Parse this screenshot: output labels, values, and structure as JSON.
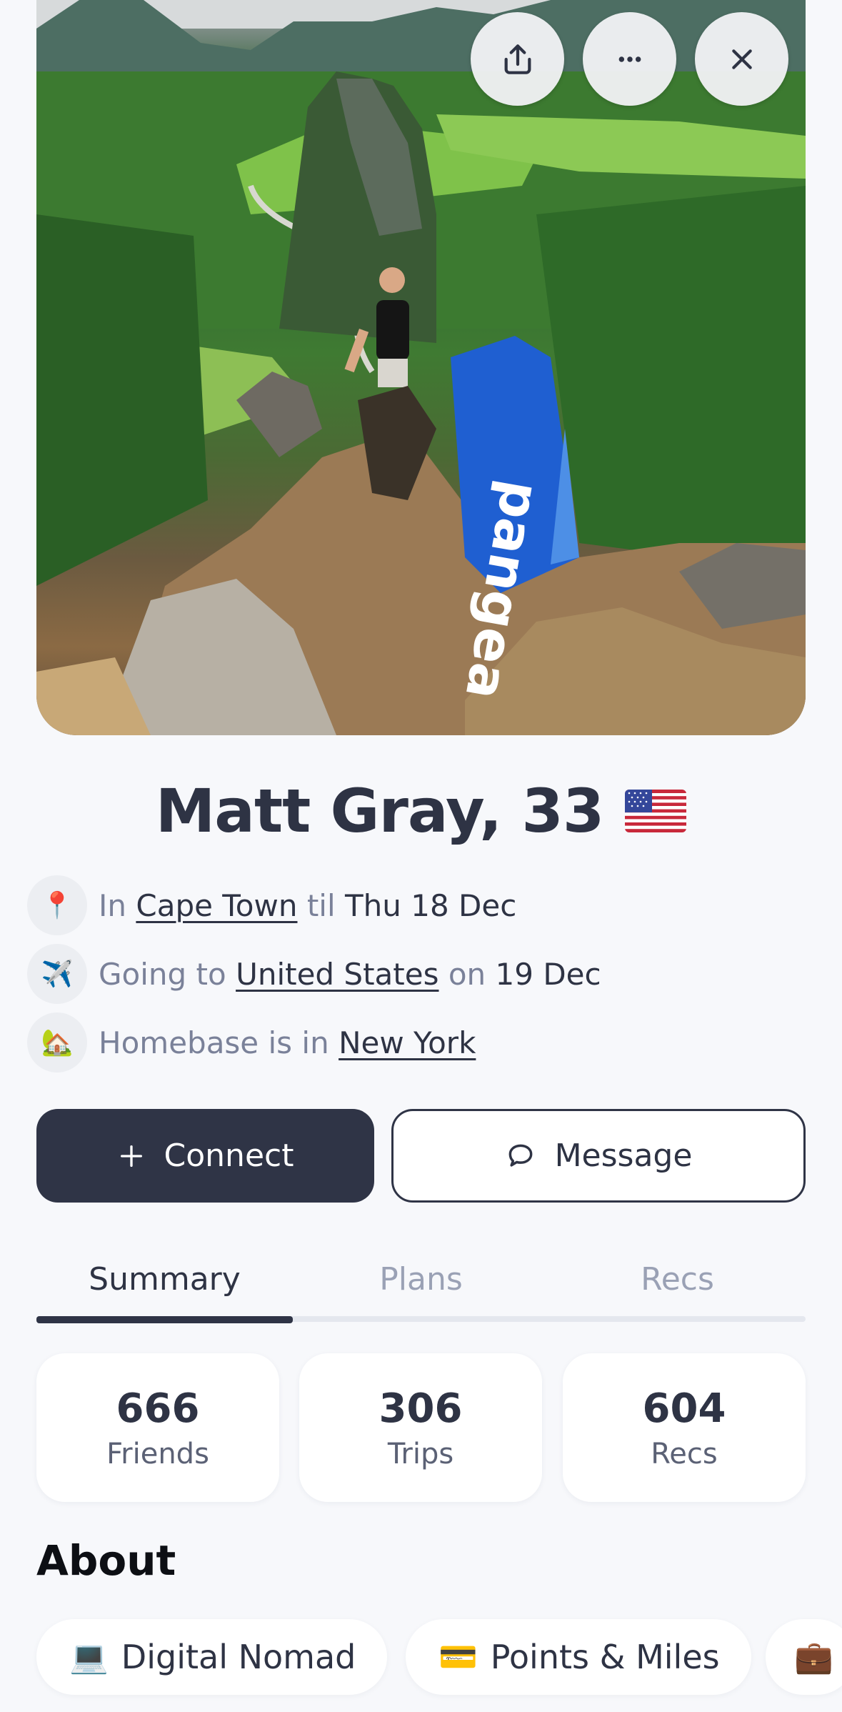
{
  "header": {
    "actions": [
      {
        "name": "share",
        "icon": "share-icon"
      },
      {
        "name": "more",
        "icon": "more-icon"
      },
      {
        "name": "close",
        "icon": "close-icon"
      }
    ]
  },
  "profile": {
    "name_age": "Matt Gray, 33",
    "flag_icon": "us-flag-icon",
    "current_location": {
      "icon": "📍",
      "prefix": "In",
      "place": "Cape Town",
      "middle": "til",
      "date": "Thu 18 Dec"
    },
    "next_trip": {
      "icon": "✈️",
      "prefix": "Going to",
      "place": "United States",
      "middle": "on",
      "date": "19 Dec"
    },
    "homebase": {
      "icon": "🏡",
      "prefix": "Homebase is in",
      "place": "New York"
    }
  },
  "actions": {
    "connect_label": "Connect",
    "message_label": "Message"
  },
  "tabs": [
    {
      "label": "Summary",
      "active": true
    },
    {
      "label": "Plans",
      "active": false
    },
    {
      "label": "Recs",
      "active": false
    }
  ],
  "stats": [
    {
      "value": "666",
      "label": "Friends"
    },
    {
      "value": "306",
      "label": "Trips"
    },
    {
      "value": "604",
      "label": "Recs"
    }
  ],
  "about": {
    "title": "About",
    "chips": [
      {
        "emoji": "💻",
        "label": "Digital Nomad"
      },
      {
        "emoji": "💳",
        "label": "Points & Miles"
      },
      {
        "emoji": "💼",
        "label": ""
      }
    ]
  },
  "colors": {
    "primary_dark": "#2f3446",
    "muted_text": "#7a8199",
    "background": "#f7f8fb",
    "flag_towel": "#1f5fd1"
  }
}
